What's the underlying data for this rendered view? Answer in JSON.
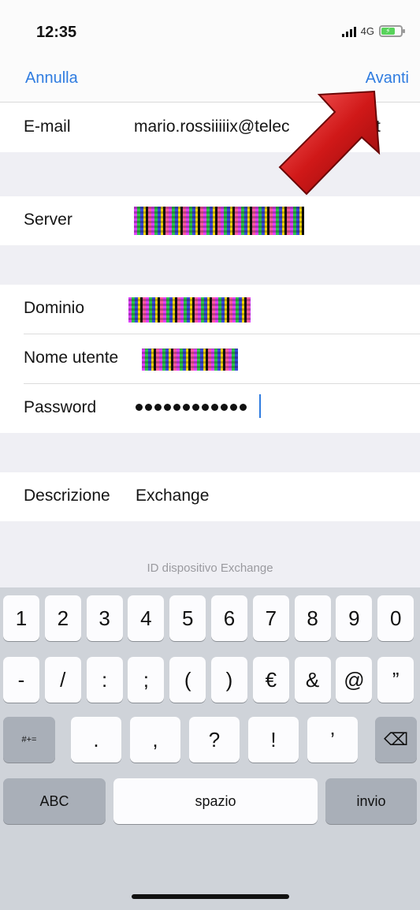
{
  "status_bar": {
    "time": "12:35",
    "network": "4G",
    "battery_symbol": "⚡"
  },
  "nav": {
    "cancel_label": "Annulla",
    "next_label": "Avanti",
    "accent_color": "#2f7ce0"
  },
  "form": {
    "email": {
      "label": "E-mail",
      "value": "mario.rossiiiiix@telec",
      "value_tail": "t"
    },
    "server": {
      "label": "Server"
    },
    "domain": {
      "label": "Dominio"
    },
    "username": {
      "label": "Nome utente"
    },
    "password": {
      "label": "Password",
      "value": "••••••••••••"
    },
    "description": {
      "label": "Descrizione",
      "value": "Exchange"
    },
    "device_id_label": "ID dispositivo Exchange"
  },
  "keyboard": {
    "row1": [
      "1",
      "2",
      "3",
      "4",
      "5",
      "6",
      "7",
      "8",
      "9",
      "0"
    ],
    "row2": [
      "-",
      "/",
      ":",
      ";",
      "(",
      ")",
      "€",
      "&",
      "@",
      "”"
    ],
    "row3_mode": "#+=",
    "row3": [
      ".",
      ",",
      "?",
      "!",
      "’"
    ],
    "delete_icon": "⌫",
    "abc_label": "ABC",
    "space_label": "spazio",
    "return_label": "invio"
  },
  "overlay": {
    "arrow_color": "#d01818"
  }
}
